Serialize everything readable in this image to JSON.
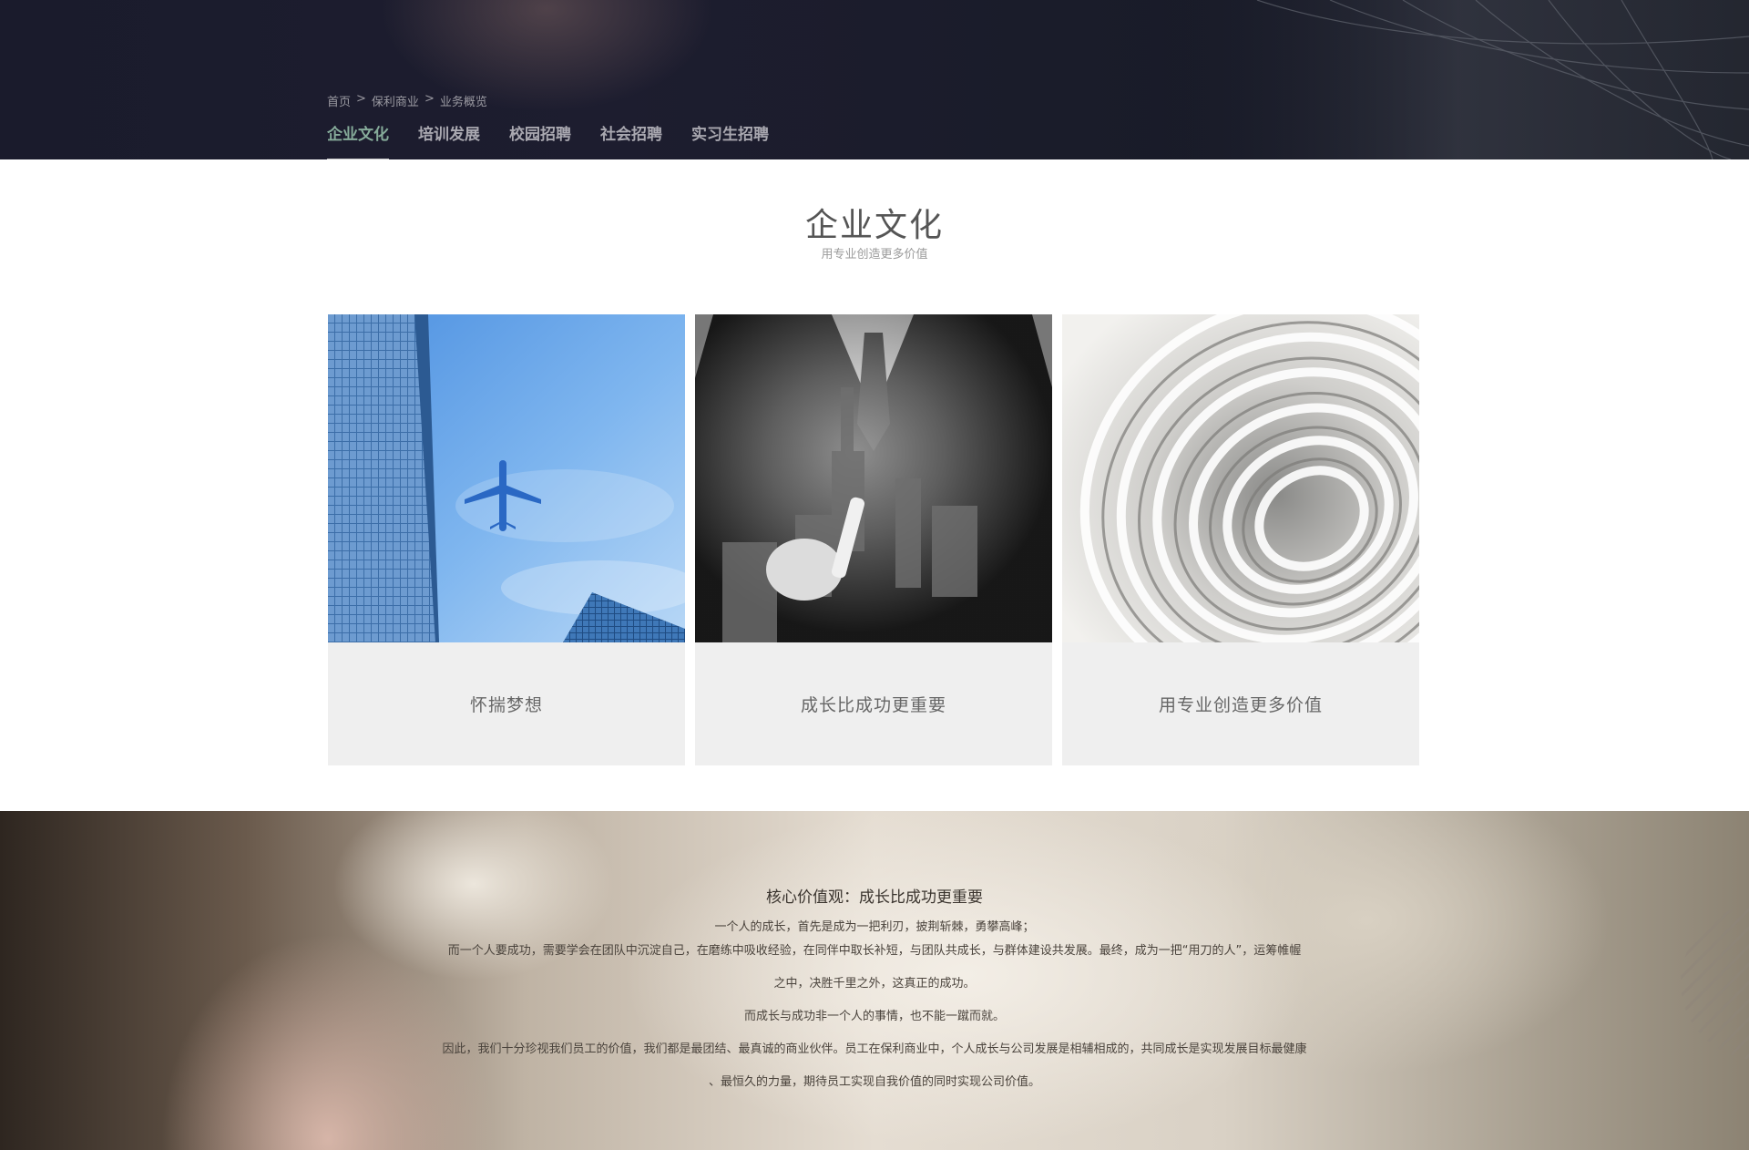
{
  "breadcrumb": {
    "items": [
      "首页",
      "保利商业",
      "业务概览"
    ],
    "separator": ">"
  },
  "subnav": {
    "items": [
      {
        "label": "企业文化",
        "active": true
      },
      {
        "label": "培训发展",
        "active": false
      },
      {
        "label": "校园招聘",
        "active": false
      },
      {
        "label": "社会招聘",
        "active": false
      },
      {
        "label": "实习生招聘",
        "active": false
      }
    ]
  },
  "section": {
    "title": "企业文化",
    "subtitle": "用专业创造更多价值"
  },
  "cards": [
    {
      "label": "怀揣梦想",
      "image": "airplane-skyscraper-photo"
    },
    {
      "label": "成长比成功更重要",
      "image": "businessman-city-photo"
    },
    {
      "label": "用专业创造更多价值",
      "image": "spiral-sculpture-photo"
    }
  ],
  "values": {
    "title": "核心价值观：成长比成功更重要",
    "lines": [
      "一个人的成长，首先是成为一把利刃，披荆斩棘，勇攀高峰；",
      "而一个人要成功，需要学会在团队中沉淀自己，在磨练中吸收经验，在同伴中取长补短，与团队共成长，与群体建设共发展。最终，成为一把“用刀的人”，运筹帷幄",
      "之中，决胜千里之外，这真正的成功。",
      "而成长与成功非一个人的事情，也不能一蹴而就。",
      "因此，我们十分珍视我们员工的价值，我们都是最团结、最真诚的商业伙伴。员工在保利商业中，个人成长与公司发展是相辅相成的，共同成长是实现发展目标最健康",
      "、最恒久的力量，期待员工实现自我价值的同时实现公司价值。"
    ]
  },
  "colors": {
    "active_nav": "#86ab9a",
    "hero_bg": "#1d1d2f",
    "card_bg": "#efefef"
  }
}
